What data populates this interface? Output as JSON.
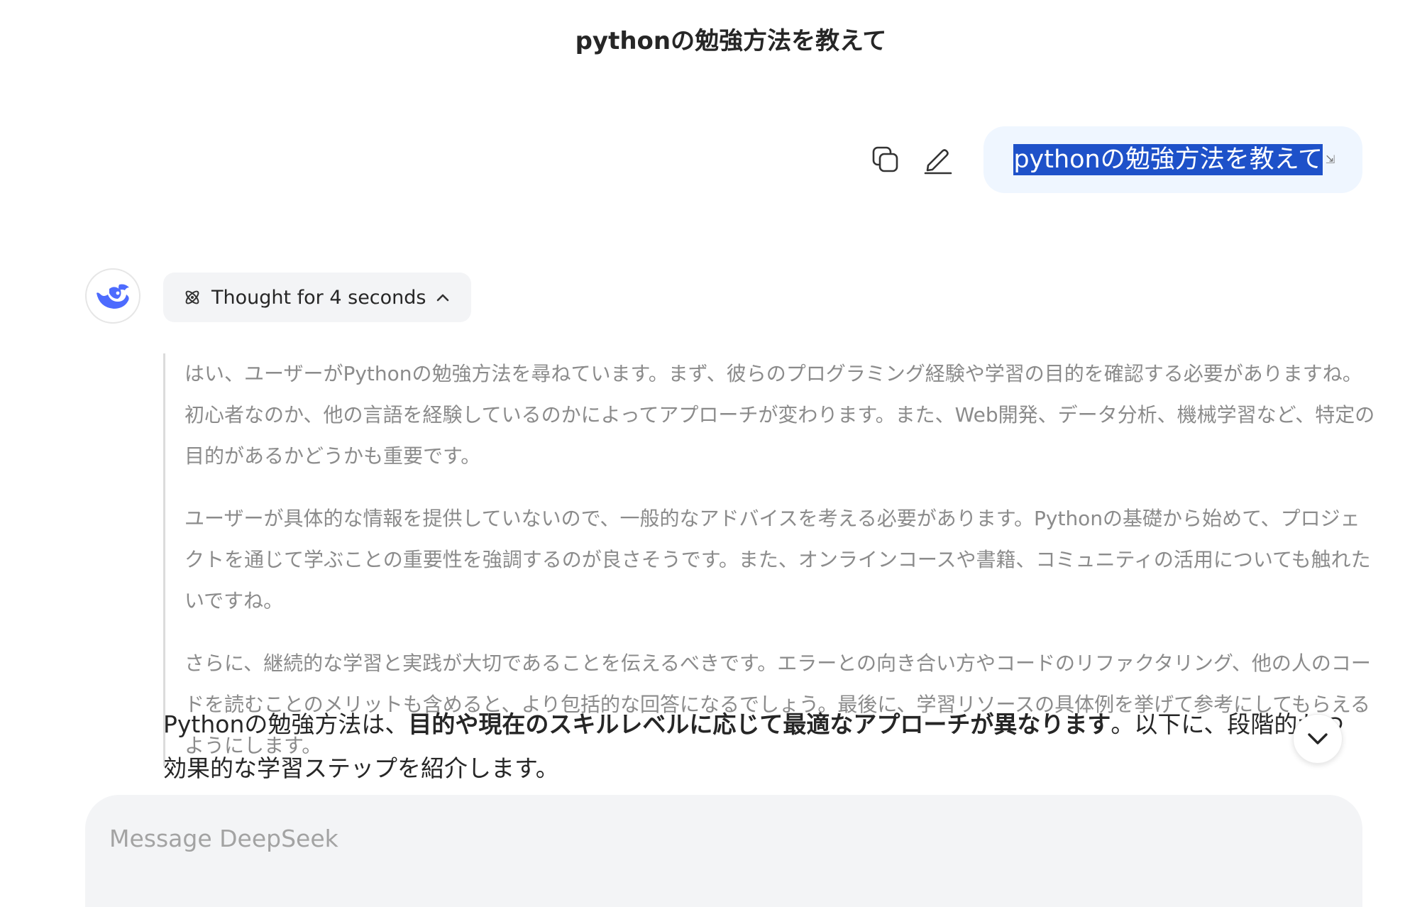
{
  "chat": {
    "title": "pythonの勉強方法を教えて"
  },
  "user_message": {
    "text": "pythonの勉強方法を教えて"
  },
  "colors": {
    "accent": "#4d6bfe",
    "selection": "#1e51c9",
    "user_bubble": "#eff6ff"
  },
  "icons": {
    "copy": "copy-icon",
    "edit": "edit-icon",
    "avatar": "deepseek-whale-logo",
    "thought": "atom-icon",
    "collapse": "chevron-up-icon",
    "scroll": "chevron-down-icon"
  },
  "assistant": {
    "thought_label": "Thought for 4 seconds",
    "thinking": [
      "はい、ユーザーがPythonの勉強方法を尋ねています。まず、彼らのプログラミング経験や学習の目的を確認する必要がありますね。初心者なのか、他の言語を経験しているのかによってアプローチが変わります。また、Web開発、データ分析、機械学習など、特定の目的があるかどうかも重要です。",
      "ユーザーが具体的な情報を提供していないので、一般的なアドバイスを考える必要があります。Pythonの基礎から始めて、プロジェクトを通じて学ぶことの重要性を強調するのが良さそうです。また、オンラインコースや書籍、コミュニティの活用についても触れたいですね。",
      "さらに、継続的な学習と実践が大切であることを伝えるべきです。エラーとの向き合い方やコードのリファクタリング、他の人のコードを読むことのメリットも含めると、より包括的な回答になるでしょう。最後に、学習リソースの具体例を挙げて参考にしてもらえるようにします。"
    ],
    "answer": {
      "prefix": "Pythonの勉強方法は、",
      "bold": "目的や現在のスキルレベルに応じて最適なアプローチが異なります",
      "suffix": "。以下に、段階的かつ効果的な学習ステップを紹介します。"
    }
  },
  "composer": {
    "placeholder": "Message DeepSeek"
  }
}
